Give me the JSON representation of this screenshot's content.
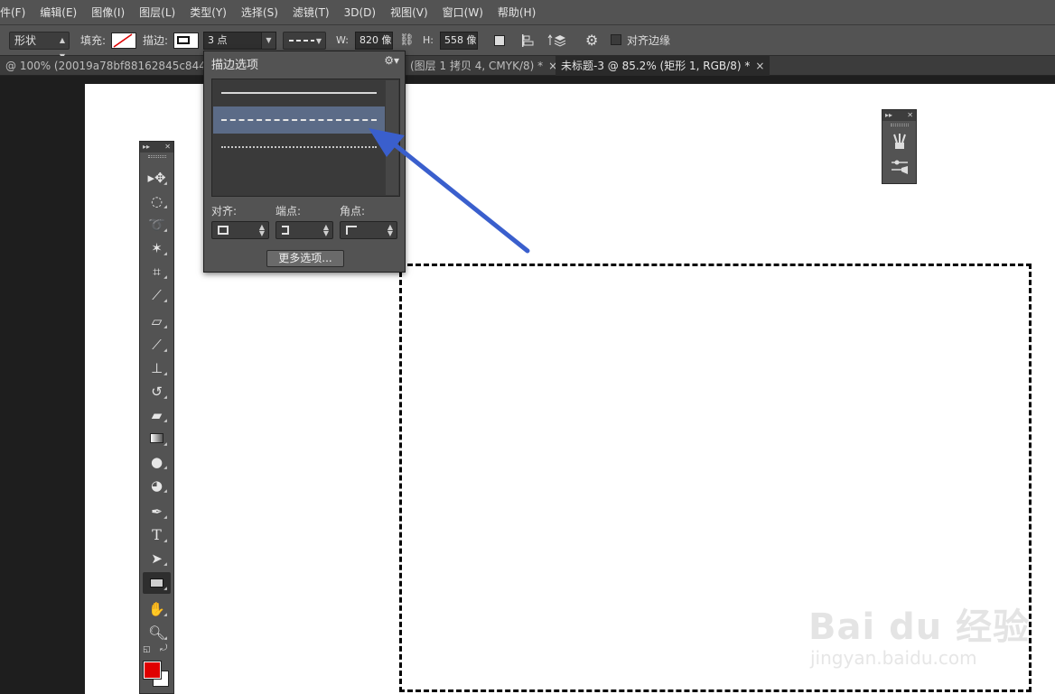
{
  "menu": [
    "件(F)",
    "编辑(E)",
    "图像(I)",
    "图层(L)",
    "类型(Y)",
    "选择(S)",
    "滤镜(T)",
    "3D(D)",
    "视图(V)",
    "窗口(W)",
    "帮助(H)"
  ],
  "options_bar": {
    "shape_mode": "形状",
    "fill_label": "填充:",
    "stroke_label": "描边:",
    "stroke_width": "3 点",
    "w_label": "W:",
    "w_value": "820 像",
    "h_label": "H:",
    "h_value": "558 像",
    "align_edges_label": "对齐边缘"
  },
  "tabs": [
    {
      "label": "@ 100% (20019a78bf88162845c8443f6",
      "active": false,
      "close": ""
    },
    {
      "label": "(图层 1 拷贝 4, CMYK/8) *",
      "active": false,
      "close": "×"
    },
    {
      "label": "未标题-3 @ 85.2% (矩形 1, RGB/8) *",
      "active": true,
      "close": "×"
    }
  ],
  "stroke_popup": {
    "title": "描边选项",
    "styles": [
      "solid",
      "dashed",
      "dotted"
    ],
    "selected_style": "dashed",
    "align_label": "对齐:",
    "caps_label": "端点:",
    "corners_label": "角点:",
    "more_button": "更多选项..."
  },
  "toolbox": {
    "tools": [
      "move-tool",
      "elliptical-marquee-tool",
      "lasso-tool",
      "magic-wand-tool",
      "crop-tool",
      "eyedropper-tool",
      "healing-brush-tool",
      "brush-tool",
      "clone-stamp-tool",
      "history-brush-tool",
      "eraser-tool",
      "gradient-tool",
      "blur-tool",
      "dodge-tool",
      "pen-tool",
      "type-tool",
      "path-selection-tool",
      "rectangle-tool",
      "hand-tool",
      "zoom-tool"
    ],
    "selected_tool": "rectangle-tool",
    "type_glyph": "T",
    "foreground_color": "#e00000",
    "background_color": "#ffffff"
  },
  "colors": {
    "accent_selection": "#5b6b87",
    "arrow": "#3a5fcd"
  },
  "watermark": {
    "brand": "Bai du 经验",
    "url": "jingyan.baidu.com"
  }
}
